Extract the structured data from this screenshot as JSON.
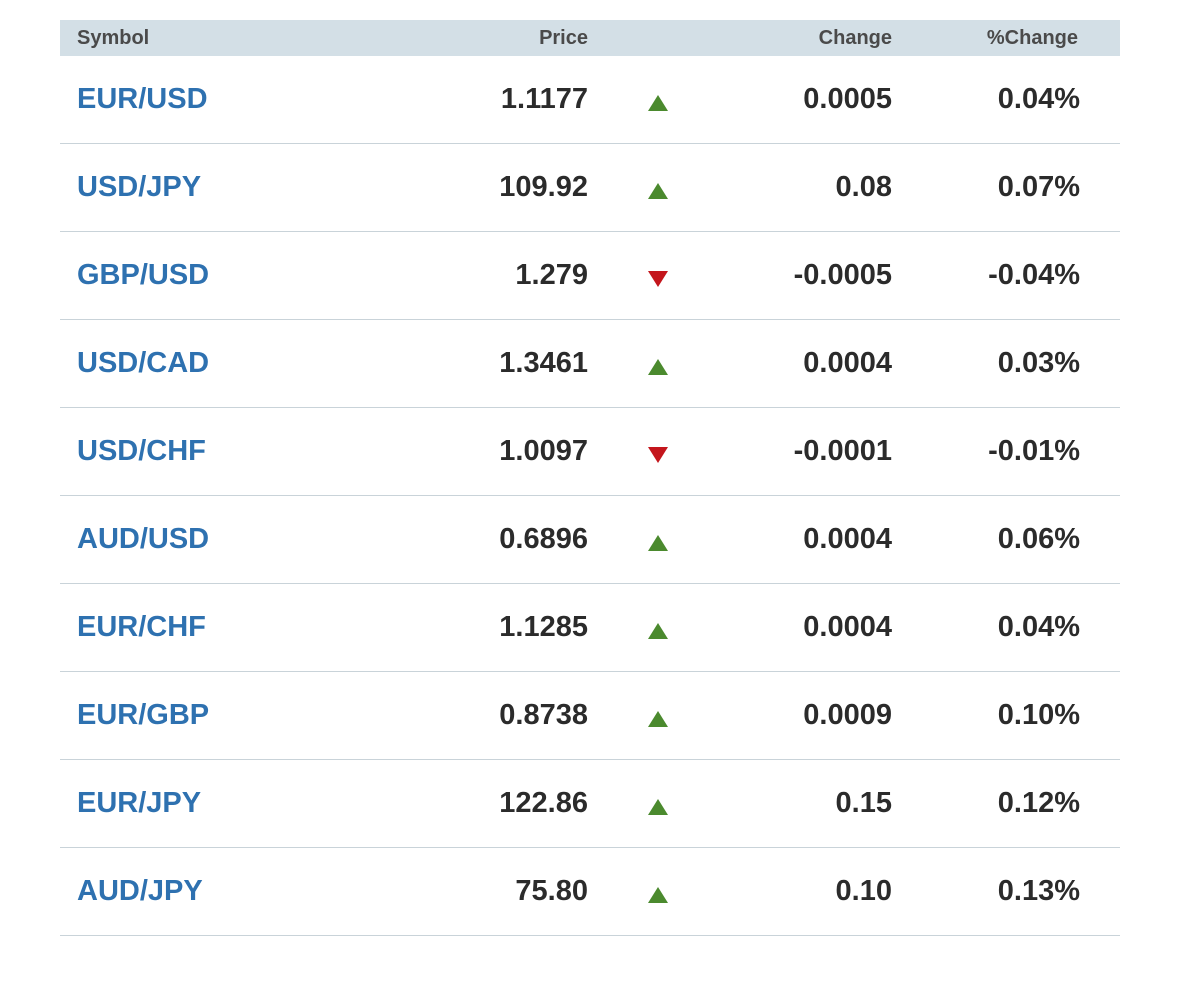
{
  "colors": {
    "header_bg": "#d3dfe6",
    "symbol_link": "#2e71b0",
    "up": "#4b8a2e",
    "down": "#c4161c"
  },
  "table": {
    "headers": {
      "symbol": "Symbol",
      "price": "Price",
      "change": "Change",
      "pct_change": "%Change"
    },
    "rows": [
      {
        "symbol": "EUR/USD",
        "price": "1.1177",
        "direction": "up",
        "change": "0.0005",
        "pct_change": "0.04%"
      },
      {
        "symbol": "USD/JPY",
        "price": "109.92",
        "direction": "up",
        "change": "0.08",
        "pct_change": "0.07%"
      },
      {
        "symbol": "GBP/USD",
        "price": "1.279",
        "direction": "down",
        "change": "-0.0005",
        "pct_change": "-0.04%"
      },
      {
        "symbol": "USD/CAD",
        "price": "1.3461",
        "direction": "up",
        "change": "0.0004",
        "pct_change": "0.03%"
      },
      {
        "symbol": "USD/CHF",
        "price": "1.0097",
        "direction": "down",
        "change": "-0.0001",
        "pct_change": "-0.01%"
      },
      {
        "symbol": "AUD/USD",
        "price": "0.6896",
        "direction": "up",
        "change": "0.0004",
        "pct_change": "0.06%"
      },
      {
        "symbol": "EUR/CHF",
        "price": "1.1285",
        "direction": "up",
        "change": "0.0004",
        "pct_change": "0.04%"
      },
      {
        "symbol": "EUR/GBP",
        "price": "0.8738",
        "direction": "up",
        "change": "0.0009",
        "pct_change": "0.10%"
      },
      {
        "symbol": "EUR/JPY",
        "price": "122.86",
        "direction": "up",
        "change": "0.15",
        "pct_change": "0.12%"
      },
      {
        "symbol": "AUD/JPY",
        "price": "75.80",
        "direction": "up",
        "change": "0.10",
        "pct_change": "0.13%"
      }
    ]
  }
}
